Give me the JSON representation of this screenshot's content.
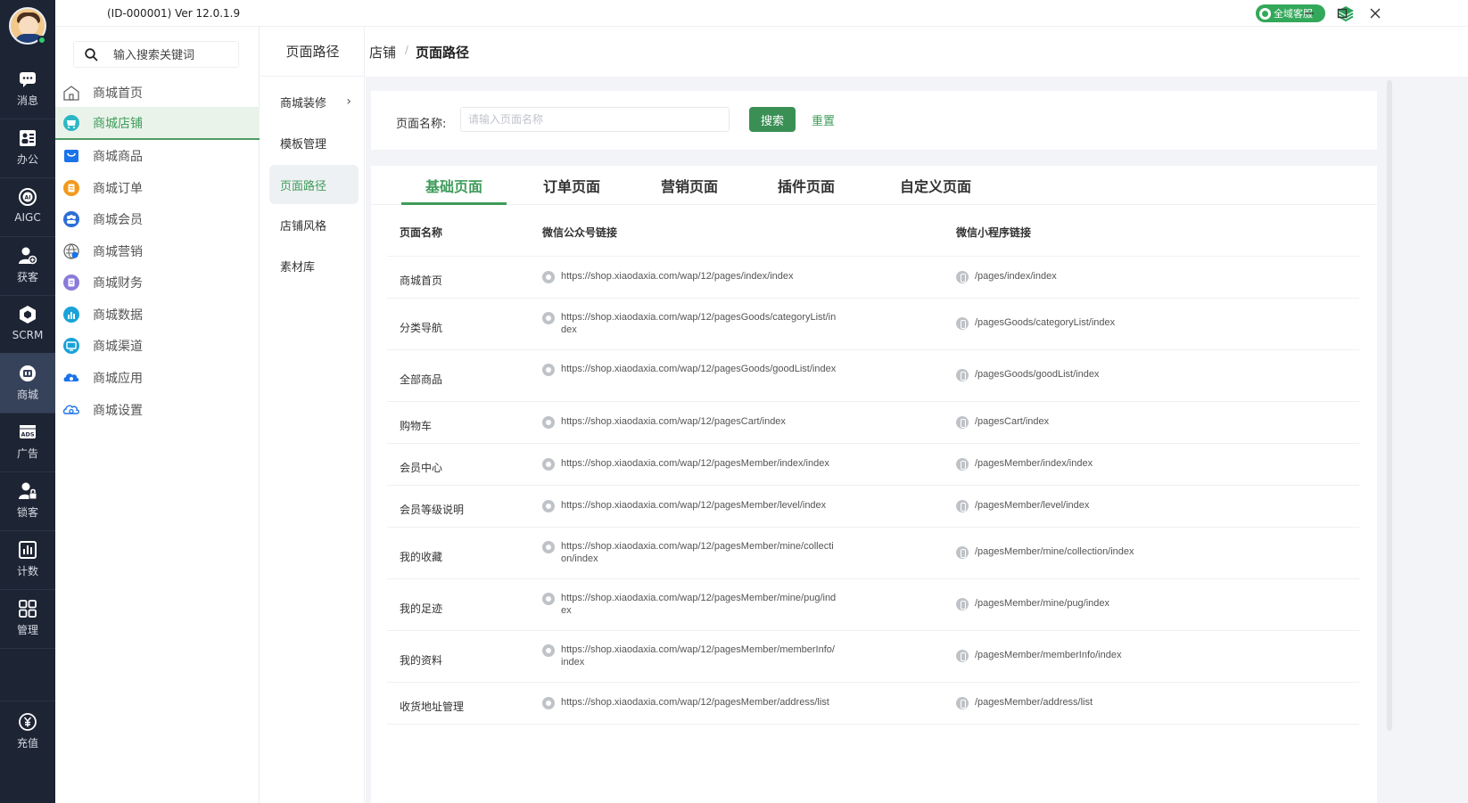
{
  "titlebar": {
    "version": "(ID-000001)  Ver 12.0.1.9",
    "service_label": "全域客服"
  },
  "rail": [
    {
      "label": "消息",
      "icon": "message-icon"
    },
    {
      "label": "办公",
      "icon": "office-icon"
    },
    {
      "label": "AIGC",
      "icon": "aigc-icon"
    },
    {
      "label": "获客",
      "icon": "acquire-icon"
    },
    {
      "label": "SCRM",
      "icon": "scrm-icon"
    },
    {
      "label": "商城",
      "icon": "mall-icon"
    },
    {
      "label": "广告",
      "icon": "ads-icon"
    },
    {
      "label": "锁客",
      "icon": "lock-customer-icon"
    },
    {
      "label": "计数",
      "icon": "count-icon"
    },
    {
      "label": "管理",
      "icon": "manage-icon"
    },
    {
      "label": "充值",
      "icon": "recharge-icon"
    }
  ],
  "menu": {
    "search_placeholder": "输入搜索关键词",
    "items": [
      {
        "label": "商城首页",
        "icon": "home-icon",
        "color": "#666666"
      },
      {
        "label": "商城店铺",
        "icon": "shop-icon",
        "color": "#2db7c5"
      },
      {
        "label": "商城商品",
        "icon": "goods-icon",
        "color": "#1a73e8"
      },
      {
        "label": "商城订单",
        "icon": "order-icon",
        "color": "#f39a1b"
      },
      {
        "label": "商城会员",
        "icon": "member-icon",
        "color": "#2d6fd6"
      },
      {
        "label": "商城营销",
        "icon": "marketing-icon",
        "color": "#666666"
      },
      {
        "label": "商城财务",
        "icon": "finance-icon",
        "color": "#8a7bd8"
      },
      {
        "label": "商城数据",
        "icon": "data-icon",
        "color": "#1aa3d8"
      },
      {
        "label": "商城渠道",
        "icon": "channel-icon",
        "color": "#1aa3d8"
      },
      {
        "label": "商城应用",
        "icon": "app-icon",
        "color": "#1a73e8"
      },
      {
        "label": "商城设置",
        "icon": "settings-icon",
        "color": "#1a73e8"
      }
    ]
  },
  "submenu": {
    "head": "页面路径",
    "items": [
      {
        "label": "商城装修"
      },
      {
        "label": "模板管理"
      },
      {
        "label": "页面路径"
      },
      {
        "label": "店铺风格"
      },
      {
        "label": "素材库"
      }
    ]
  },
  "breadcrumb": {
    "parent": "店铺",
    "sep": "/",
    "current": "页面路径"
  },
  "filter": {
    "label": "页面名称:",
    "placeholder": "请输入页面名称",
    "search": "搜索",
    "reset": "重置"
  },
  "tabs": [
    "基础页面",
    "订单页面",
    "营销页面",
    "插件页面",
    "自定义页面"
  ],
  "table": {
    "headers": [
      "页面名称",
      "微信公众号链接",
      "微信小程序链接"
    ],
    "rows": [
      {
        "name": "商城首页",
        "wx": "https://shop.xiaodaxia.com/wap/12/pages/index/index",
        "mp": "/pages/index/index"
      },
      {
        "name": "分类导航",
        "wx": "https://shop.xiaodaxia.com/wap/12/pagesGoods/categoryList/index",
        "mp": "/pagesGoods/categoryList/index"
      },
      {
        "name": "全部商品",
        "wx": "https://shop.xiaodaxia.com/wap/12/pagesGoods/goodList/index",
        "mp": "/pagesGoods/goodList/index"
      },
      {
        "name": "购物车",
        "wx": "https://shop.xiaodaxia.com/wap/12/pagesCart/index",
        "mp": "/pagesCart/index"
      },
      {
        "name": "会员中心",
        "wx": "https://shop.xiaodaxia.com/wap/12/pagesMember/index/index",
        "mp": "/pagesMember/index/index"
      },
      {
        "name": "会员等级说明",
        "wx": "https://shop.xiaodaxia.com/wap/12/pagesMember/level/index",
        "mp": "/pagesMember/level/index"
      },
      {
        "name": "我的收藏",
        "wx": "https://shop.xiaodaxia.com/wap/12/pagesMember/mine/collection/index",
        "mp": "/pagesMember/mine/collection/index"
      },
      {
        "name": "我的足迹",
        "wx": "https://shop.xiaodaxia.com/wap/12/pagesMember/mine/pug/index",
        "mp": "/pagesMember/mine/pug/index"
      },
      {
        "name": "我的资料",
        "wx": "https://shop.xiaodaxia.com/wap/12/pagesMember/memberInfo/index",
        "mp": "/pagesMember/memberInfo/index"
      },
      {
        "name": "收货地址管理",
        "wx": "https://shop.xiaodaxia.com/wap/12/pagesMember/address/list",
        "mp": "/pagesMember/address/list"
      }
    ]
  },
  "colors": {
    "accent": "#3f9c5a",
    "rail": "#1d2433"
  }
}
